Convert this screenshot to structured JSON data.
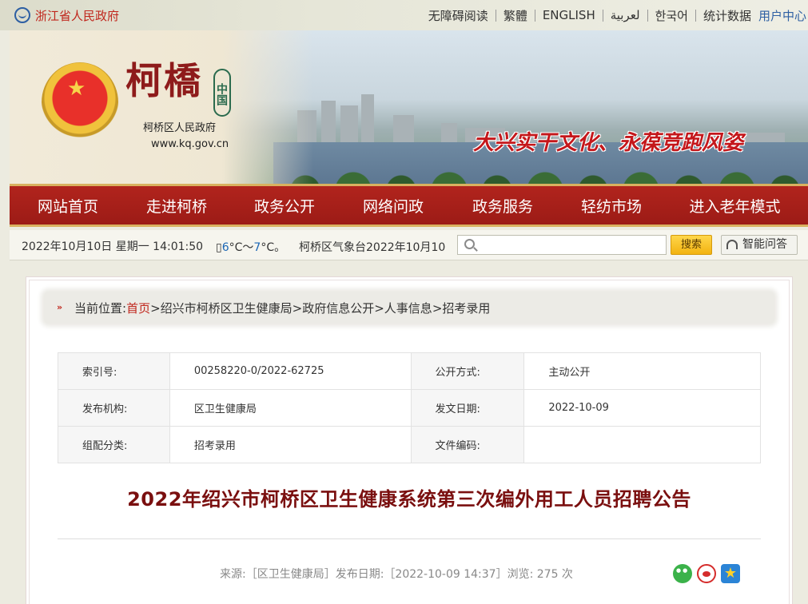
{
  "topbar": {
    "province_link": "浙江省人民政府",
    "links": [
      "无障碍阅读",
      "繁體",
      "ENGLISH",
      "لعربية",
      "한국어",
      "统计数据"
    ],
    "user_center": "用户中心"
  },
  "banner": {
    "brand_title": "柯橋",
    "brand_china": "中国",
    "brand_name": "柯桥区人民政府",
    "brand_url": "www.kq.gov.cn",
    "slogan": "大兴实干文化、永葆竞跑风姿"
  },
  "nav": {
    "items": [
      "网站首页",
      "走进柯桥",
      "政务公开",
      "网络问政",
      "政务服务",
      "轻纺市场",
      "进入老年模式"
    ]
  },
  "infobar": {
    "datetime": "2022年10月10日 星期一 14:01:50",
    "weather_prefix": "",
    "weather_low": "6",
    "weather_mid": "°C～",
    "weather_high": "7",
    "weather_suffix": "°C。",
    "ticker": "柯桥区气象台2022年10月10",
    "search_placeholder": "",
    "search_button": "搜索",
    "qa_button": "智能问答"
  },
  "breadcrumb": {
    "prefix": "当前位置:",
    "home": "首页",
    "trail": [
      ">绍兴市柯桥区卫生健康局",
      " >政府信息公开",
      " >人事信息",
      " >招考录用"
    ]
  },
  "meta": {
    "rows": [
      {
        "k1": "索引号:",
        "v1": "00258220-0/2022-62725",
        "k2": "公开方式:",
        "v2": "主动公开"
      },
      {
        "k1": "发布机构:",
        "v1": "区卫生健康局",
        "k2": "发文日期:",
        "v2": "2022-10-09"
      },
      {
        "k1": "组配分类:",
        "v1": "招考录用",
        "k2": "文件编码:",
        "v2": ""
      }
    ]
  },
  "article": {
    "title": "2022年绍兴市柯桥区卫生健康系统第三次编外用工人员招聘公告",
    "source_line": "来源:［区卫生健康局］发布日期:［2022-10-09 14:37］浏览:  275 次"
  },
  "share": {
    "icons": [
      "wechat-icon",
      "weibo-icon",
      "qzone-icon"
    ]
  },
  "colors": {
    "nav_red": "#a31e18",
    "accent_gold": "#d9b15f",
    "title_red": "#7a0f0f",
    "link_red": "#c0261c"
  }
}
